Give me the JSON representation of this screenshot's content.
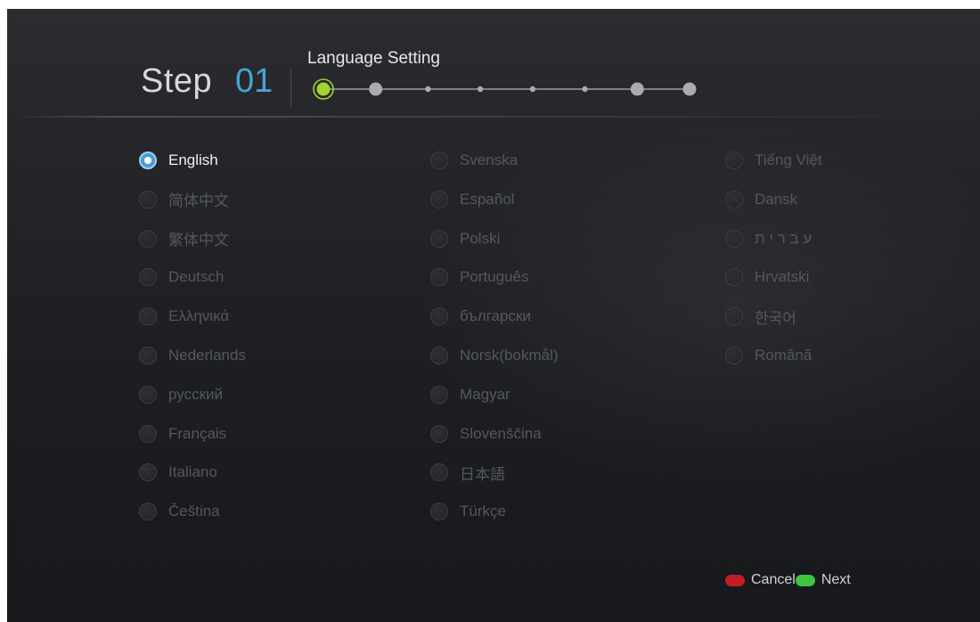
{
  "header": {
    "step_label": "Step",
    "step_number": "01",
    "title": "Language Setting"
  },
  "progress": {
    "total_steps": 8,
    "current_step": 1,
    "accent_color": "#9ed62b"
  },
  "languages": [
    {
      "label": "English",
      "selected": true
    },
    {
      "label": "简体中文",
      "selected": false
    },
    {
      "label": "繁体中文",
      "selected": false
    },
    {
      "label": "Deutsch",
      "selected": false
    },
    {
      "label": "Ελληνικά",
      "selected": false
    },
    {
      "label": "Nederlands",
      "selected": false
    },
    {
      "label": "русский",
      "selected": false
    },
    {
      "label": "Français",
      "selected": false
    },
    {
      "label": "Italiano",
      "selected": false
    },
    {
      "label": "Čeština",
      "selected": false
    },
    {
      "label": "Svenska",
      "selected": false
    },
    {
      "label": "Español",
      "selected": false
    },
    {
      "label": "Polski",
      "selected": false
    },
    {
      "label": "Português",
      "selected": false
    },
    {
      "label": "български",
      "selected": false
    },
    {
      "label": "Norsk(bokmål)",
      "selected": false
    },
    {
      "label": "Magyar",
      "selected": false
    },
    {
      "label": "Slovenščina",
      "selected": false
    },
    {
      "label": "日本語",
      "selected": false
    },
    {
      "label": "Türkçe",
      "selected": false
    },
    {
      "label": "Tiếng Việt",
      "selected": false
    },
    {
      "label": "Dansk",
      "selected": false
    },
    {
      "label": "ע ב ר י ת",
      "selected": false
    },
    {
      "label": "Hrvatski",
      "selected": false
    },
    {
      "label": "한국어",
      "selected": false
    },
    {
      "label": "Română",
      "selected": false
    }
  ],
  "footer": {
    "cancel_label": "Cancel",
    "next_label": "Next",
    "cancel_color": "#c21d26",
    "next_color": "#3ec43e"
  }
}
